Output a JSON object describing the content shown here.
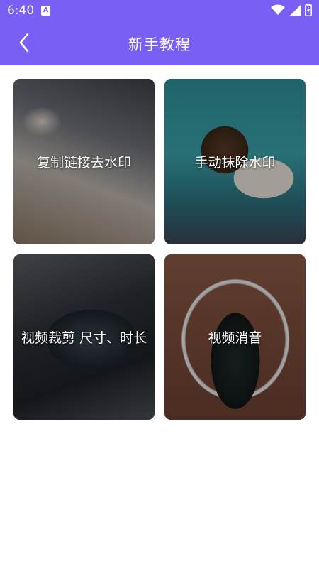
{
  "status_bar": {
    "time": "6:40",
    "notification_icon": "a-icon",
    "icons": [
      "wifi-icon",
      "signal-icon",
      "battery-icon"
    ]
  },
  "app_bar": {
    "back_icon": "chevron-left-icon",
    "title": "新手教程"
  },
  "tutorials": [
    {
      "label": "复制链接去水印"
    },
    {
      "label": "手动抹除水印"
    },
    {
      "label": "视频裁剪 尺寸、时长"
    },
    {
      "label": "视频消音"
    }
  ],
  "colors": {
    "accent": "#7b5ef3",
    "background": "#ffffff",
    "card_text": "#ffffff"
  }
}
